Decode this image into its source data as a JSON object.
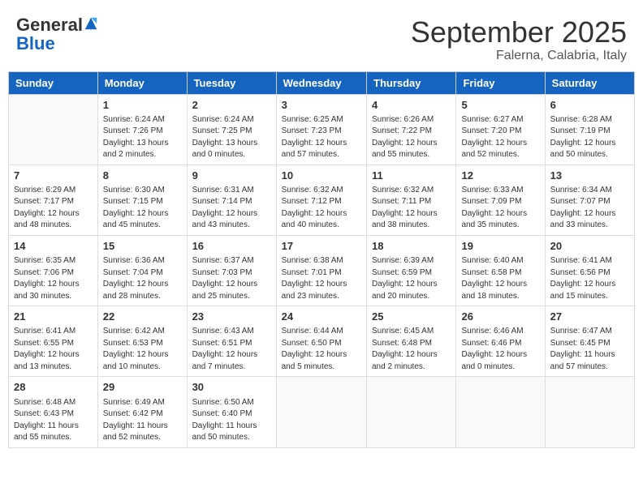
{
  "header": {
    "logo_general": "General",
    "logo_blue": "Blue",
    "month": "September 2025",
    "location": "Falerna, Calabria, Italy"
  },
  "days_of_week": [
    "Sunday",
    "Monday",
    "Tuesday",
    "Wednesday",
    "Thursday",
    "Friday",
    "Saturday"
  ],
  "weeks": [
    [
      {
        "day": "",
        "info": ""
      },
      {
        "day": "1",
        "info": "Sunrise: 6:24 AM\nSunset: 7:26 PM\nDaylight: 13 hours\nand 2 minutes."
      },
      {
        "day": "2",
        "info": "Sunrise: 6:24 AM\nSunset: 7:25 PM\nDaylight: 13 hours\nand 0 minutes."
      },
      {
        "day": "3",
        "info": "Sunrise: 6:25 AM\nSunset: 7:23 PM\nDaylight: 12 hours\nand 57 minutes."
      },
      {
        "day": "4",
        "info": "Sunrise: 6:26 AM\nSunset: 7:22 PM\nDaylight: 12 hours\nand 55 minutes."
      },
      {
        "day": "5",
        "info": "Sunrise: 6:27 AM\nSunset: 7:20 PM\nDaylight: 12 hours\nand 52 minutes."
      },
      {
        "day": "6",
        "info": "Sunrise: 6:28 AM\nSunset: 7:19 PM\nDaylight: 12 hours\nand 50 minutes."
      }
    ],
    [
      {
        "day": "7",
        "info": "Sunrise: 6:29 AM\nSunset: 7:17 PM\nDaylight: 12 hours\nand 48 minutes."
      },
      {
        "day": "8",
        "info": "Sunrise: 6:30 AM\nSunset: 7:15 PM\nDaylight: 12 hours\nand 45 minutes."
      },
      {
        "day": "9",
        "info": "Sunrise: 6:31 AM\nSunset: 7:14 PM\nDaylight: 12 hours\nand 43 minutes."
      },
      {
        "day": "10",
        "info": "Sunrise: 6:32 AM\nSunset: 7:12 PM\nDaylight: 12 hours\nand 40 minutes."
      },
      {
        "day": "11",
        "info": "Sunrise: 6:32 AM\nSunset: 7:11 PM\nDaylight: 12 hours\nand 38 minutes."
      },
      {
        "day": "12",
        "info": "Sunrise: 6:33 AM\nSunset: 7:09 PM\nDaylight: 12 hours\nand 35 minutes."
      },
      {
        "day": "13",
        "info": "Sunrise: 6:34 AM\nSunset: 7:07 PM\nDaylight: 12 hours\nand 33 minutes."
      }
    ],
    [
      {
        "day": "14",
        "info": "Sunrise: 6:35 AM\nSunset: 7:06 PM\nDaylight: 12 hours\nand 30 minutes."
      },
      {
        "day": "15",
        "info": "Sunrise: 6:36 AM\nSunset: 7:04 PM\nDaylight: 12 hours\nand 28 minutes."
      },
      {
        "day": "16",
        "info": "Sunrise: 6:37 AM\nSunset: 7:03 PM\nDaylight: 12 hours\nand 25 minutes."
      },
      {
        "day": "17",
        "info": "Sunrise: 6:38 AM\nSunset: 7:01 PM\nDaylight: 12 hours\nand 23 minutes."
      },
      {
        "day": "18",
        "info": "Sunrise: 6:39 AM\nSunset: 6:59 PM\nDaylight: 12 hours\nand 20 minutes."
      },
      {
        "day": "19",
        "info": "Sunrise: 6:40 AM\nSunset: 6:58 PM\nDaylight: 12 hours\nand 18 minutes."
      },
      {
        "day": "20",
        "info": "Sunrise: 6:41 AM\nSunset: 6:56 PM\nDaylight: 12 hours\nand 15 minutes."
      }
    ],
    [
      {
        "day": "21",
        "info": "Sunrise: 6:41 AM\nSunset: 6:55 PM\nDaylight: 12 hours\nand 13 minutes."
      },
      {
        "day": "22",
        "info": "Sunrise: 6:42 AM\nSunset: 6:53 PM\nDaylight: 12 hours\nand 10 minutes."
      },
      {
        "day": "23",
        "info": "Sunrise: 6:43 AM\nSunset: 6:51 PM\nDaylight: 12 hours\nand 7 minutes."
      },
      {
        "day": "24",
        "info": "Sunrise: 6:44 AM\nSunset: 6:50 PM\nDaylight: 12 hours\nand 5 minutes."
      },
      {
        "day": "25",
        "info": "Sunrise: 6:45 AM\nSunset: 6:48 PM\nDaylight: 12 hours\nand 2 minutes."
      },
      {
        "day": "26",
        "info": "Sunrise: 6:46 AM\nSunset: 6:46 PM\nDaylight: 12 hours\nand 0 minutes."
      },
      {
        "day": "27",
        "info": "Sunrise: 6:47 AM\nSunset: 6:45 PM\nDaylight: 11 hours\nand 57 minutes."
      }
    ],
    [
      {
        "day": "28",
        "info": "Sunrise: 6:48 AM\nSunset: 6:43 PM\nDaylight: 11 hours\nand 55 minutes."
      },
      {
        "day": "29",
        "info": "Sunrise: 6:49 AM\nSunset: 6:42 PM\nDaylight: 11 hours\nand 52 minutes."
      },
      {
        "day": "30",
        "info": "Sunrise: 6:50 AM\nSunset: 6:40 PM\nDaylight: 11 hours\nand 50 minutes."
      },
      {
        "day": "",
        "info": ""
      },
      {
        "day": "",
        "info": ""
      },
      {
        "day": "",
        "info": ""
      },
      {
        "day": "",
        "info": ""
      }
    ]
  ]
}
